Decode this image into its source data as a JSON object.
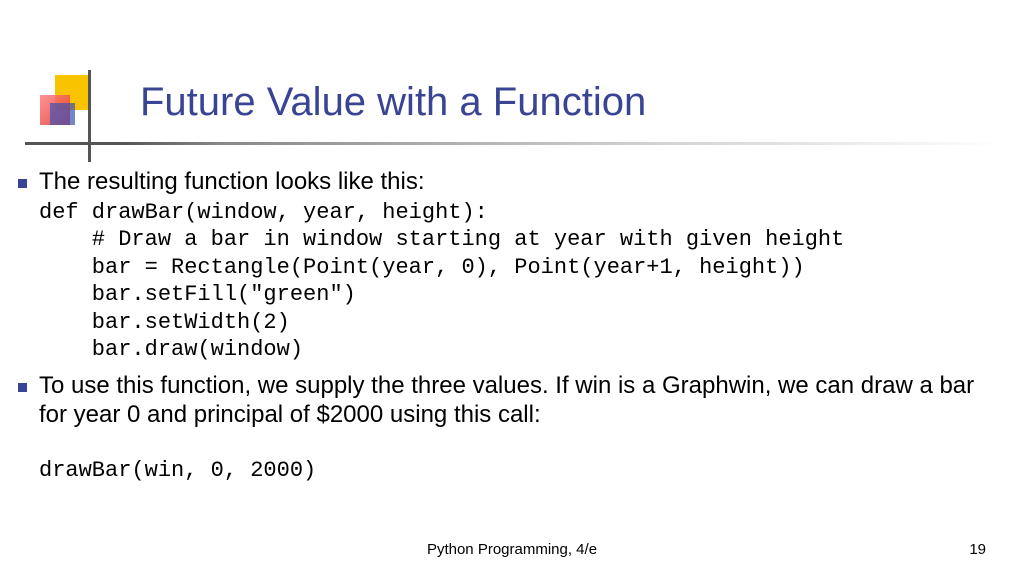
{
  "title": "Future Value with a Function",
  "bullets": {
    "b1": "The resulting function looks like this:",
    "b2": "To use this function, we supply the three values. If win is a Graphwin, we can draw a bar for year 0 and principal of $2000 using this call:"
  },
  "code": {
    "block1": "def drawBar(window, year, height):\n    # Draw a bar in window starting at year with given height\n    bar = Rectangle(Point(year, 0), Point(year+1, height))\n    bar.setFill(\"green\")\n    bar.setWidth(2)\n    bar.draw(window)",
    "block2": "drawBar(win, 0, 2000)"
  },
  "footer": {
    "center": "Python Programming, 4/e",
    "page": "19"
  }
}
